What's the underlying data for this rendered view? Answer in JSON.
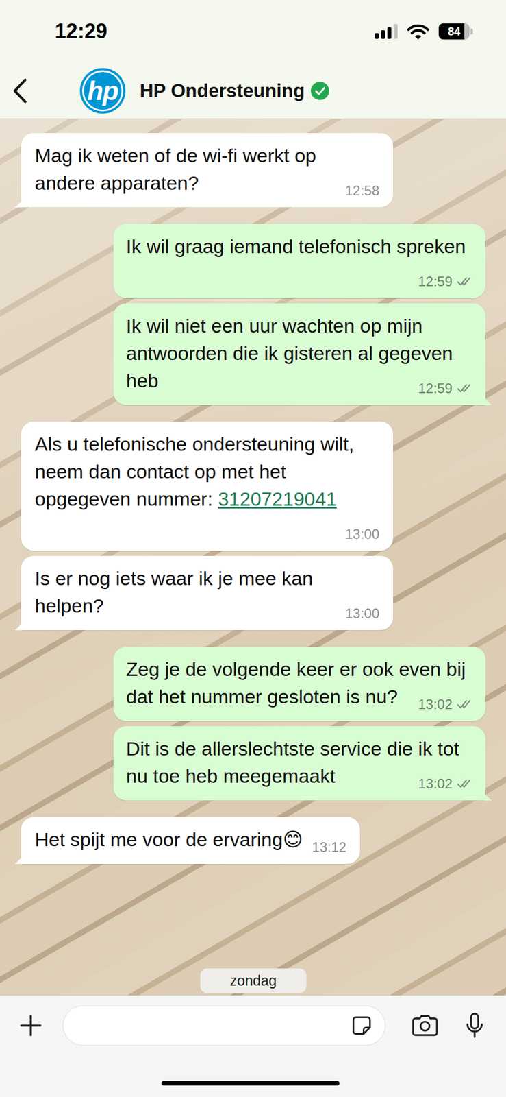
{
  "status_bar": {
    "time": "12:29",
    "signal": {
      "level": 0.75
    },
    "battery": {
      "reading": "84",
      "level": 0.84
    }
  },
  "header": {
    "logo": "hp",
    "title": "HP Ondersteuning",
    "verified": true
  },
  "messages": [
    {
      "kind": "incoming",
      "text": "Mag ik weten of de wi-fi werkt op andere apparaten?",
      "time": "12:58"
    },
    {
      "kind": "outgoing",
      "text": "Ik wil graag iemand telefonisch spreken",
      "time": "12:59",
      "delivered": true
    },
    {
      "kind": "outgoing",
      "text": "Ik wil niet een uur wachten op mijn antwoorden die ik gisteren al gegeven heb",
      "time": "12:59",
      "delivered": true
    },
    {
      "kind": "incoming",
      "text": "Als u telefonische ondersteuning wilt, neem dan contact op met het opgegeven nummer: ",
      "link": "31207219041",
      "time": "13:00"
    },
    {
      "kind": "incoming",
      "text": "Is er nog iets waar ik je mee kan helpen?",
      "time": "13:00"
    },
    {
      "kind": "outgoing",
      "text": "Zeg je de volgende keer er ook even bij dat het nummer gesloten is nu?",
      "time": "13:02",
      "delivered": true
    },
    {
      "kind": "outgoing",
      "text": "Dit is de allerslechtste service die ik tot nu toe heb meegemaakt",
      "time": "13:02",
      "delivered": true
    },
    {
      "kind": "incoming",
      "text": "Het spijt me voor de ervaring😊",
      "time": "13:12"
    }
  ],
  "date_chip": "zondag"
}
